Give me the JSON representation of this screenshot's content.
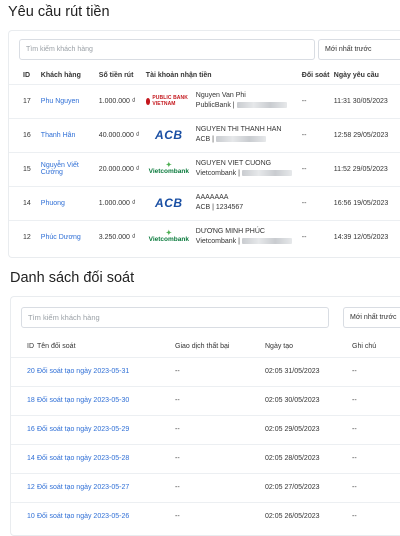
{
  "withdraw": {
    "title": "Yêu cầu rút tiền",
    "search_placeholder": "Tìm kiếm khách hàng",
    "sort_value": "Mới nhất trước",
    "columns": [
      "ID",
      "Khách hàng",
      "Số tiền rút",
      "Tài khoản nhận tiền",
      "Đối soát",
      "Ngày yêu cầu"
    ],
    "rows": [
      {
        "id": "17",
        "customer": "Phu Nguyen",
        "amount": "1.000.000 ₫",
        "bank_logo": "PUBLIC BANK VIETNAM",
        "logo_type": "public",
        "holder": "Nguyen Van Phi",
        "bank_name": "PublicBank |",
        "reconcile": "--",
        "date": "11:31 30/05/2023"
      },
      {
        "id": "16",
        "customer": "Thanh Hân",
        "amount": "40.000.000 ₫",
        "bank_logo": "ACB",
        "logo_type": "acb",
        "holder": "NGUYEN THI THANH HAN",
        "bank_name": "ACB |",
        "reconcile": "--",
        "date": "12:58 29/05/2023"
      },
      {
        "id": "15",
        "customer": "Nguyễn Viết Cường",
        "amount": "20.000.000 ₫",
        "bank_logo": "Vietcombank",
        "logo_type": "vcb",
        "holder": "NGUYEN VIET CUONG",
        "bank_name": "Vietcombank |",
        "reconcile": "--",
        "date": "11:52 29/05/2023"
      },
      {
        "id": "14",
        "customer": "Phuong",
        "amount": "1.000.000 ₫",
        "bank_logo": "ACB",
        "logo_type": "acb",
        "holder": "AAAAAAA",
        "bank_name": "ACB | 1234567",
        "reconcile": "--",
        "date": "16:56 19/05/2023"
      },
      {
        "id": "12",
        "customer": "Phúc Dương",
        "amount": "3.250.000 ₫",
        "bank_logo": "Vietcombank",
        "logo_type": "vcb",
        "holder": "DƯƠNG MINH PHÚC",
        "bank_name": "Vietcombank |",
        "reconcile": "--",
        "date": "14:39 12/05/2023"
      }
    ]
  },
  "reconcile": {
    "title": "Danh sách đối soát",
    "search_placeholder": "Tìm kiếm khách hàng",
    "sort_value": "Mới nhất trước",
    "columns": [
      "ID",
      "Tên đối soát",
      "Giao dịch thất bại",
      "Ngày tạo",
      "Ghi chú"
    ],
    "rows": [
      {
        "id": "20",
        "name": "Đối soát tạo ngày 2023-05-31",
        "failed": "--",
        "created": "02:05 31/05/2023",
        "note": "--"
      },
      {
        "id": "18",
        "name": "Đối soát tạo ngày 2023-05-30",
        "failed": "--",
        "created": "02:05 30/05/2023",
        "note": "--"
      },
      {
        "id": "16",
        "name": "Đối soát tạo ngày 2023-05-29",
        "failed": "--",
        "created": "02:05 29/05/2023",
        "note": "--"
      },
      {
        "id": "14",
        "name": "Đối soát tạo ngày 2023-05-28",
        "failed": "--",
        "created": "02:05 28/05/2023",
        "note": "--"
      },
      {
        "id": "12",
        "name": "Đối soát tạo ngày 2023-05-27",
        "failed": "--",
        "created": "02:05 27/05/2023",
        "note": "--"
      },
      {
        "id": "10",
        "name": "Đối soát tạo ngày 2023-05-26",
        "failed": "--",
        "created": "02:05 26/05/2023",
        "note": "--"
      }
    ]
  }
}
